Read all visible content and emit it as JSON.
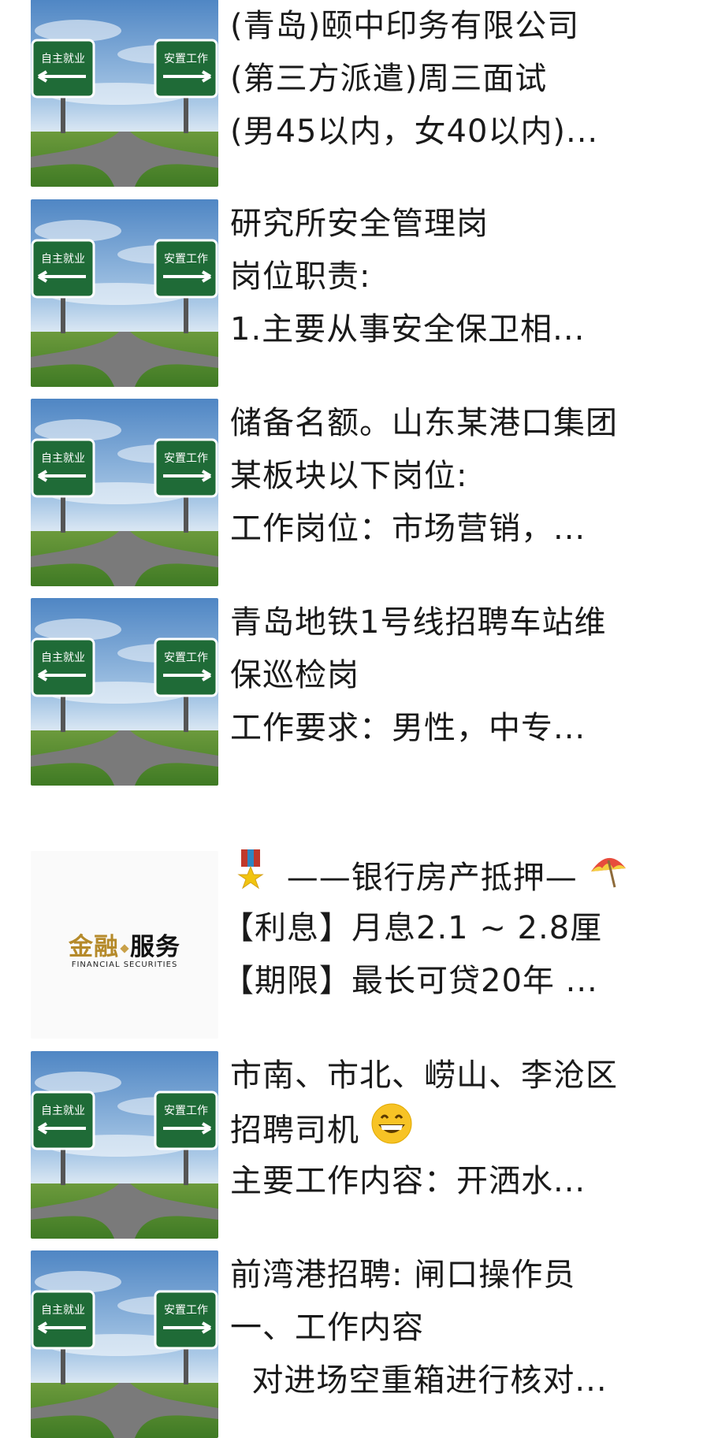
{
  "colors": {
    "sign_green": "#1f6b37",
    "sky_top": "#4f86c4",
    "grass": "#4e8b2a",
    "road": "#7a7a7a",
    "logo_gold": "#b58a2a"
  },
  "sign": {
    "left_label": "自主就业",
    "right_label": "安置工作"
  },
  "finance_logo": {
    "main_left": "金融",
    "main_right": "服务",
    "sub": "FINANCIAL SECURITIES"
  },
  "items": [
    {
      "thumb": "crossroads-signs",
      "lines": [
        "(青岛)颐中印务有限公司",
        "(第三方派遣)周三面试",
        "(男45以内，女40以内)..."
      ]
    },
    {
      "thumb": "crossroads-signs",
      "lines": [
        "研究所安全管理岗",
        "岗位职责:",
        "1.主要从事安全保卫相..."
      ]
    },
    {
      "thumb": "crossroads-signs",
      "lines": [
        "储备名额。山东某港口集团",
        "某板块以下岗位:",
        "工作岗位：市场营销，..."
      ]
    },
    {
      "thumb": "crossroads-signs",
      "lines": [
        "青岛地铁1号线招聘车站维",
        "保巡检岗",
        "工作要求：男性，中专..."
      ]
    },
    {
      "thumb": "finance-logo",
      "lines": [
        "——银行房产抵押—",
        "【利息】月息2.1 ~ 2.8厘",
        "【期限】最长可贷20年 ..."
      ],
      "leading_icon": "medal-icon",
      "trailing_icon": "umbrella-icon"
    },
    {
      "thumb": "crossroads-signs",
      "lines": [
        "市南、市北、崂山、李沧区",
        "招聘司机",
        "主要工作内容：开洒水..."
      ],
      "inline_icon": "grinning-face-icon"
    },
    {
      "thumb": "crossroads-signs",
      "lines": [
        "前湾港招聘: 闸口操作员",
        "一、工作内容",
        "  对进场空重箱进行核对..."
      ]
    }
  ]
}
